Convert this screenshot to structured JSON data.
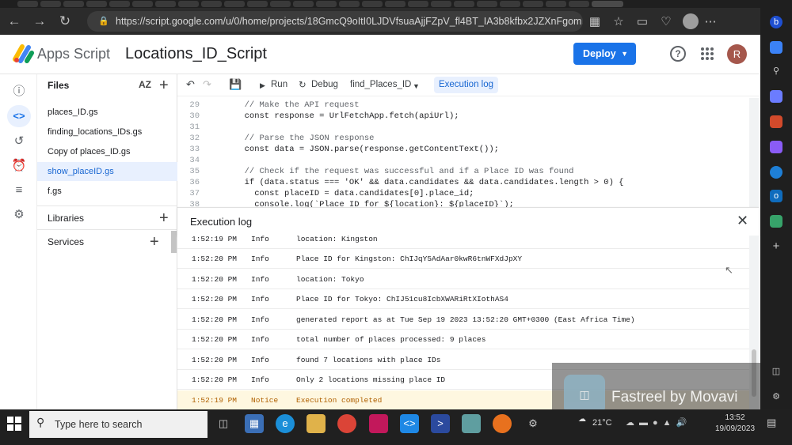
{
  "browser": {
    "url": "https://script.google.com/u/0/home/projects/18GmcQ9oItI0LJDVfsuaAjjFZpV_fl4BT_IA3b8kfbx2JZXnFgom...",
    "back_icon": "back-arrow-icon",
    "forward_icon": "forward-arrow-icon",
    "refresh_icon": "refresh-icon"
  },
  "header": {
    "brand": "Apps Script",
    "project_title": "Locations_ID_Script",
    "deploy_label": "Deploy",
    "avatar_letter": "R"
  },
  "files_panel": {
    "title": "Files",
    "sort_label": "AZ",
    "files": [
      {
        "name": "places_ID.gs",
        "selected": false
      },
      {
        "name": "finding_locations_IDs.gs",
        "selected": false
      },
      {
        "name": "Copy of places_ID.gs",
        "selected": false
      },
      {
        "name": "show_placeID.gs",
        "selected": true
      },
      {
        "name": "f.gs",
        "selected": false
      }
    ],
    "libraries_label": "Libraries",
    "services_label": "Services"
  },
  "toolbar": {
    "run_label": "Run",
    "debug_label": "Debug",
    "function_select": "find_Places_ID",
    "execution_log_label": "Execution log"
  },
  "code": {
    "lines": [
      {
        "n": "29",
        "text": "  // Make the API request"
      },
      {
        "n": "30",
        "text": "  const response = UrlFetchApp.fetch(apiUrl);"
      },
      {
        "n": "31",
        "text": ""
      },
      {
        "n": "32",
        "text": "  // Parse the JSON response"
      },
      {
        "n": "33",
        "text": "  const data = JSON.parse(response.getContentText());"
      },
      {
        "n": "34",
        "text": ""
      },
      {
        "n": "35",
        "text": "  // Check if the request was successful and if a Place ID was found"
      },
      {
        "n": "36",
        "text": "  if (data.status === 'OK' && data.candidates && data.candidates.length > 0) {"
      },
      {
        "n": "37",
        "text": "    const placeID = data.candidates[0].place_id;"
      },
      {
        "n": "38",
        "text": "    console.log(`Place ID for ${location}: ${placeID}`);"
      }
    ]
  },
  "execution_log": {
    "title": "Execution log",
    "rows": [
      {
        "time": "1:52:19 PM",
        "level": "Info",
        "message": "location: Kingston",
        "notice": false
      },
      {
        "time": "1:52:20 PM",
        "level": "Info",
        "message": "Place ID for Kingston: ChIJqY5AdAar0kwR6tnWFXdJpXY",
        "notice": false
      },
      {
        "time": "1:52:20 PM",
        "level": "Info",
        "message": "location: Tokyo",
        "notice": false
      },
      {
        "time": "1:52:20 PM",
        "level": "Info",
        "message": "Place ID for Tokyo: ChIJ51cu8IcbXWARiRtXIothAS4",
        "notice": false
      },
      {
        "time": "1:52:20 PM",
        "level": "Info",
        "message": "generated report as at Tue Sep 19 2023 13:52:20 GMT+0300 (East Africa Time)",
        "notice": false
      },
      {
        "time": "1:52:20 PM",
        "level": "Info",
        "message": "total number of places processed: 9 places",
        "notice": false
      },
      {
        "time": "1:52:20 PM",
        "level": "Info",
        "message": "found 7 locations with place IDs",
        "notice": false
      },
      {
        "time": "1:52:20 PM",
        "level": "Info",
        "message": "Only 2 locations missing place ID",
        "notice": false
      },
      {
        "time": "1:52:19 PM",
        "level": "Notice",
        "message": "Execution completed",
        "notice": true
      }
    ]
  },
  "watermark": {
    "text": "Fastreel by Movavi"
  },
  "taskbar": {
    "search_placeholder": "Type here to search",
    "temperature": "21°C",
    "time": "13:52",
    "date": "19/09/2023"
  },
  "colors": {
    "accent": "#1a73e8",
    "selected_bg": "#e8f0fe",
    "notice_bg": "#fef7e0"
  }
}
